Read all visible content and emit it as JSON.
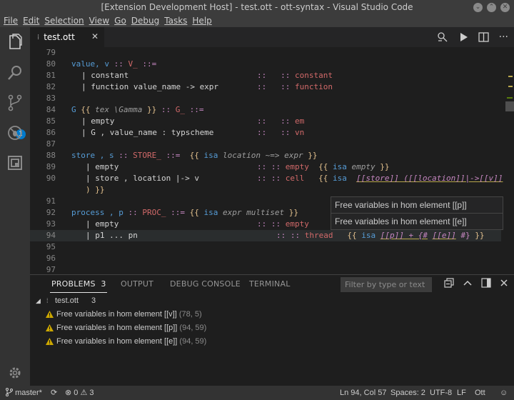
{
  "window": {
    "title": "[Extension Development Host] - test.ott - ott-syntax - Visual Studio Code"
  },
  "menu": [
    "File",
    "Edit",
    "Selection",
    "View",
    "Go",
    "Debug",
    "Tasks",
    "Help"
  ],
  "activity": {
    "scm_badge": "1"
  },
  "tab": {
    "label": "test.ott",
    "close": "✕"
  },
  "hover": {
    "lines": [
      "Free variables in hom element [[p]]",
      "Free variables in hom element [[e]]"
    ]
  },
  "panel": {
    "tabs": [
      {
        "label": "PROBLEMS",
        "count": "3"
      },
      {
        "label": "OUTPUT"
      },
      {
        "label": "DEBUG CONSOLE"
      },
      {
        "label": "TERMINAL"
      }
    ],
    "filter_placeholder": "Filter by type or text",
    "file": {
      "name": "test.ott",
      "count": "3"
    },
    "problems": [
      {
        "message": "Free variables in hom element [[v]]",
        "location": "(78, 5)"
      },
      {
        "message": "Free variables in hom element [[p]]",
        "location": "(94, 59)"
      },
      {
        "message": "Free variables in hom element [[e]]",
        "location": "(94, 59)"
      }
    ]
  },
  "status": {
    "branch": "master*",
    "errors": "0",
    "warnings": "3",
    "position": "Ln 94, Col 57",
    "spaces": "Spaces: 2",
    "encoding": "UTF-8",
    "eol": "LF",
    "language": "Ott"
  },
  "code": {
    "line_numbers": [
      "79",
      "80",
      "81",
      "82",
      "83",
      "84",
      "85",
      "86",
      "87",
      "88",
      "89",
      "90",
      "",
      "91",
      "92",
      "93",
      "94",
      "95",
      "96",
      "97"
    ],
    "l80": [
      "value, v",
      "::",
      "V_",
      "::="
    ],
    "l81": [
      "| constant",
      "::",
      "::",
      "constant"
    ],
    "l82": [
      "| function value_name -> expr",
      "::",
      "::",
      "function"
    ],
    "l84": [
      "G",
      "{{",
      "tex \\Gamma",
      "}}",
      "::",
      "G_",
      "::="
    ],
    "l85": [
      "| empty",
      "::",
      "::",
      "em"
    ],
    "l86": [
      "| G , value_name : typscheme",
      "::",
      "::",
      "vn"
    ],
    "l88": [
      "store , s",
      "::",
      "STORE_",
      "::=",
      "{{",
      "isa",
      "location ~=> expr",
      "}}"
    ],
    "l89": [
      "| empty",
      ":: ::",
      "empty",
      "{{",
      "isa",
      "empty",
      "}}"
    ],
    "l90": [
      "| store , location |-> v",
      ":: ::",
      "cell",
      "{{",
      "isa",
      "[[store]] ([[location]]|->[[v]]",
      ") }}"
    ],
    "l92": [
      "process , p",
      "::",
      "PROC_",
      "::=",
      "{{",
      "isa",
      "expr multiset",
      "}}"
    ],
    "l93": [
      "| empty",
      ":: ::",
      "empty"
    ],
    "l94": [
      "| p1 ... pn",
      ":: ::",
      "thread",
      "{{",
      "isa",
      "[[p]] + {#",
      "[[e]]",
      "#}",
      "}}"
    ]
  }
}
